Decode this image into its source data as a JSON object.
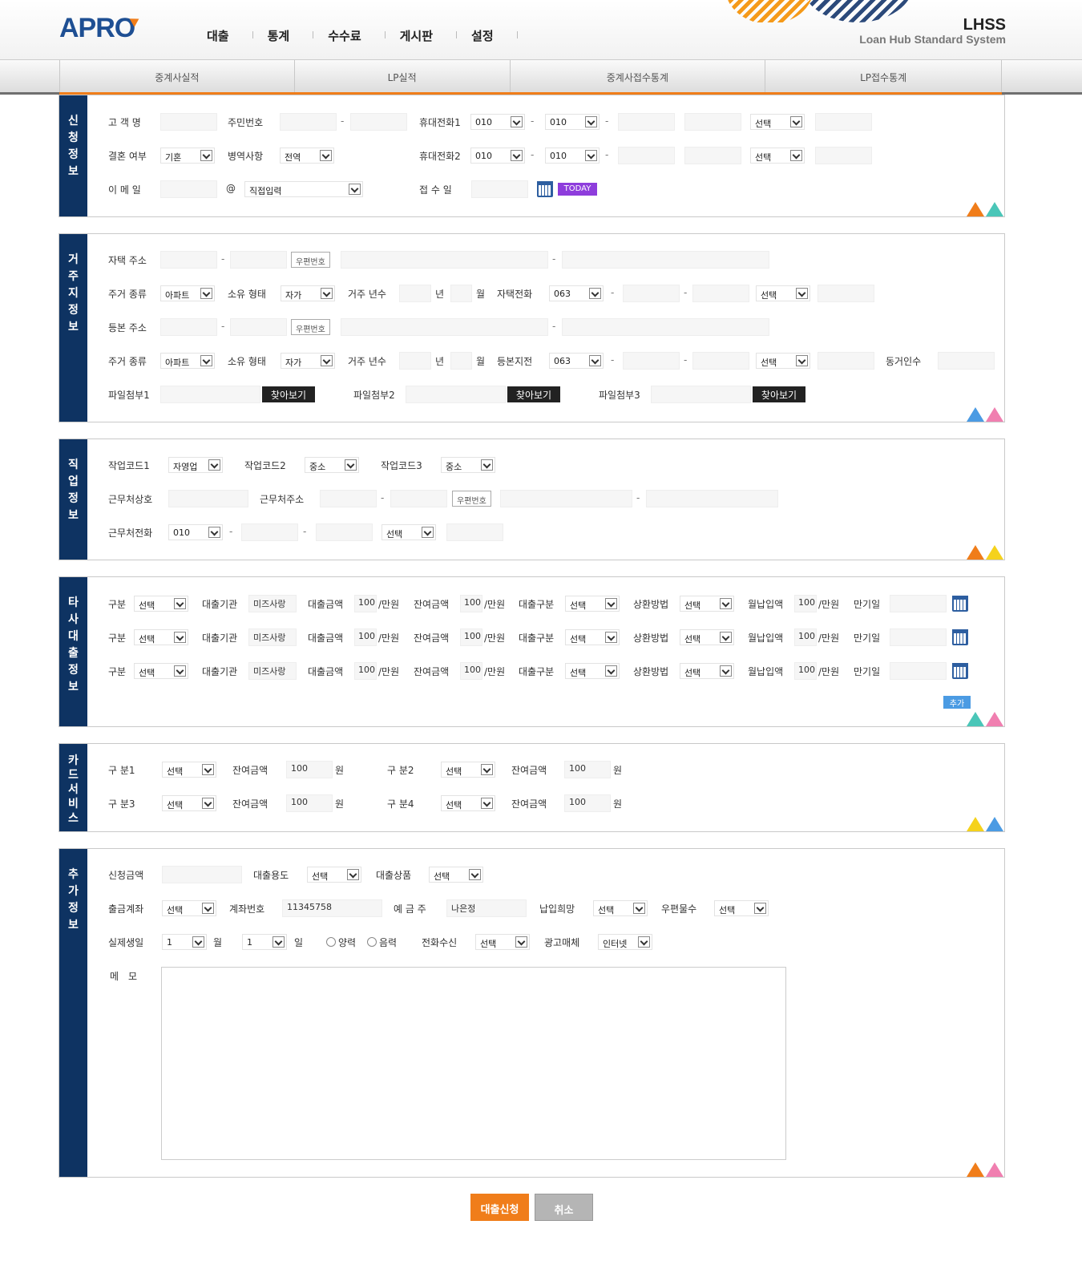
{
  "brand": {
    "logo": "APRO",
    "name": "LHSS",
    "subtitle": "Loan Hub Standard System"
  },
  "gnb": [
    "대출",
    "통계",
    "수수료",
    "게시판",
    "설정"
  ],
  "snb": [
    "중계사실적",
    "LP실적",
    "중계사접수통계",
    "LP접수통계"
  ],
  "s1": {
    "title": "신청정보",
    "name": "고 객 명",
    "rrn": "주민번호",
    "phone1": "휴대전화1",
    "phone2": "휴대전화2",
    "p1a": "010",
    "p1b": "010",
    "p1c": "선택",
    "p2a": "010",
    "p2b": "010",
    "p2c": "선택",
    "married": "결혼 여부",
    "married_v": "기혼",
    "military": "병역사항",
    "military_v": "전역",
    "email": "이 메 일",
    "at": "@",
    "email_v": "직접입력",
    "date": "접 수 일",
    "today": "TODAY"
  },
  "s2": {
    "title": "거주지정보",
    "addr1": "자택 주소",
    "zip": "우편번호",
    "htype": "주거 종류",
    "htype_v": "아파트",
    "own": "소유 형태",
    "own_v": "자가",
    "years": "거주 년수",
    "y": "년",
    "m": "월",
    "hphone": "자택전화",
    "hphone_v": "063",
    "sel": "선택",
    "addr2": "등본 주소",
    "rphone": "등본지전",
    "fam": "동거인수",
    "f1": "파일첨부1",
    "f2": "파일첨부2",
    "f3": "파일첨부3",
    "find": "찾아보기"
  },
  "s3": {
    "title": "직업정보",
    "j1": "작업코드1",
    "j1v": "자영업",
    "j2": "작업코드2",
    "j2v": "중소",
    "j3": "작업코드3",
    "j3v": "중소",
    "cname": "근무처상호",
    "caddr": "근무처주소",
    "zip": "우편번호",
    "cphone": "근무처전화",
    "cp1": "010",
    "cp2": "선택"
  },
  "s4": {
    "title": "타사대출정보",
    "rows": [
      {
        "g": "구분",
        "gv": "선택",
        "org": "대출기관",
        "orgv": "미즈사랑",
        "amt": "대출금액",
        "amtv": "100",
        "unit": "/만원",
        "bal": "잔여금액",
        "balv": "100",
        "type": "대출구분",
        "typev": "선택",
        "rep": "상환방법",
        "repv": "선택",
        "mon": "월납입액",
        "monv": "100",
        "due": "만기일"
      },
      {
        "g": "구분",
        "gv": "선택",
        "org": "대출기관",
        "orgv": "미즈사랑",
        "amt": "대출금액",
        "amtv": "100",
        "unit": "/만원",
        "bal": "잔여금액",
        "balv": "100",
        "type": "대출구분",
        "typev": "선택",
        "rep": "상환방법",
        "repv": "선택",
        "mon": "월납입액",
        "monv": "100",
        "due": "만기일"
      },
      {
        "g": "구분",
        "gv": "선택",
        "org": "대출기관",
        "orgv": "미즈사랑",
        "amt": "대출금액",
        "amtv": "100",
        "unit": "/만원",
        "bal": "잔여금액",
        "balv": "100",
        "type": "대출구분",
        "typev": "선택",
        "rep": "상환방법",
        "repv": "선택",
        "mon": "월납입액",
        "monv": "100",
        "due": "만기일"
      }
    ],
    "add": "추가"
  },
  "s5": {
    "title": "카드서비스",
    "g1": "구 분1",
    "g2": "구 분2",
    "g3": "구 분3",
    "g4": "구 분4",
    "sel": "선택",
    "bal": "잔여금액",
    "v": "100",
    "won": "원"
  },
  "s6": {
    "title": "추가정보",
    "amt": "신청금액",
    "use": "대출용도",
    "prod": "대출상품",
    "sel": "선택",
    "acct": "출금계좌",
    "acctno": "계좌번호",
    "acctno_v": "11345758",
    "owner": "예 금 주",
    "owner_v": "나은정",
    "pay": "납입희망",
    "mail": "우편물수",
    "birth": "실제생일",
    "one": "1",
    "mo": "월",
    "day": "일",
    "solar": "양력",
    "lunar": "음력",
    "call": "전화수신",
    "ad": "광고매체",
    "ad_v": "인터넷",
    "memo": "메　모"
  },
  "buttons": {
    "submit": "대출신청",
    "cancel": "취소"
  },
  "colors": {
    "navy": "#0e3362",
    "orange": "#f07d1a",
    "purple": "#8e3ddc"
  }
}
